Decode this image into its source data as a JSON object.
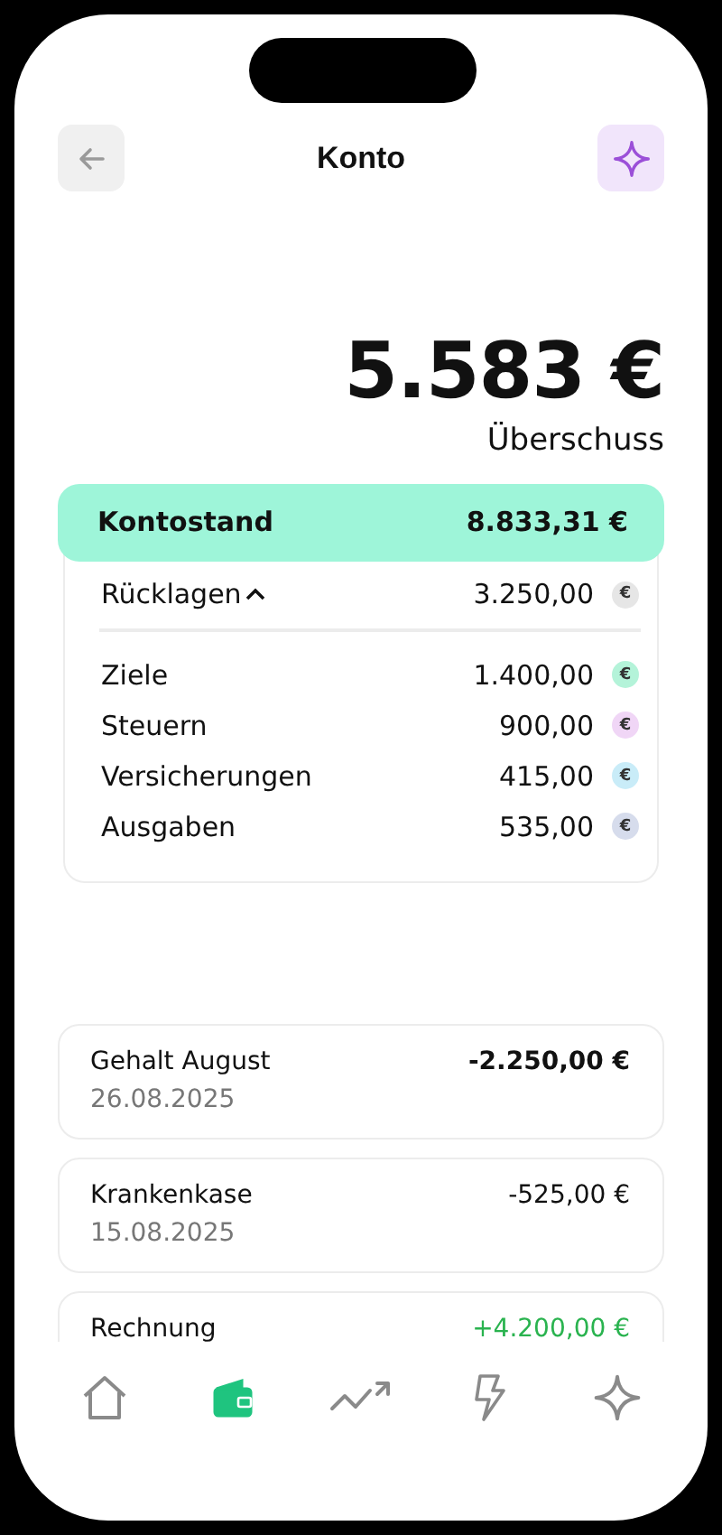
{
  "header": {
    "title": "Konto"
  },
  "summary": {
    "amount": "5.583 €",
    "label": "Überschuss"
  },
  "balance": {
    "label": "Kontostand",
    "amount": "8.833,31 €"
  },
  "reserves": {
    "label": "Rücklagen",
    "amount": "3.250,00",
    "coin": "€",
    "color": "#e6e6e6",
    "expanded": true,
    "items": [
      {
        "label": "Ziele",
        "amount": "1.400,00",
        "coin": "€",
        "color": "#b4f3d9"
      },
      {
        "label": "Steuern",
        "amount": "900,00",
        "coin": "€",
        "color": "#f0d6f6"
      },
      {
        "label": "Versicherungen",
        "amount": "415,00",
        "coin": "€",
        "color": "#c9ecf8"
      },
      {
        "label": "Ausgaben",
        "amount": "535,00",
        "coin": "€",
        "color": "#d6dcec"
      }
    ]
  },
  "transactions": [
    {
      "title": "Gehalt August",
      "date": "26.08.2025",
      "amount": "-2.250,00 €",
      "kind": "expense",
      "emphasized": true
    },
    {
      "title": "Krankenkase",
      "date": "15.08.2025",
      "amount": "-525,00 €",
      "kind": "expense",
      "emphasized": false
    },
    {
      "title": "Rechnung",
      "amount": "+4.200,00 €",
      "kind": "income",
      "emphasized": false
    }
  ],
  "nav": [
    {
      "kind": "home",
      "selected": false
    },
    {
      "kind": "wallet",
      "selected": true
    },
    {
      "kind": "trend",
      "selected": false
    },
    {
      "kind": "bolt",
      "selected": false
    },
    {
      "kind": "sparkle",
      "selected": false
    }
  ]
}
